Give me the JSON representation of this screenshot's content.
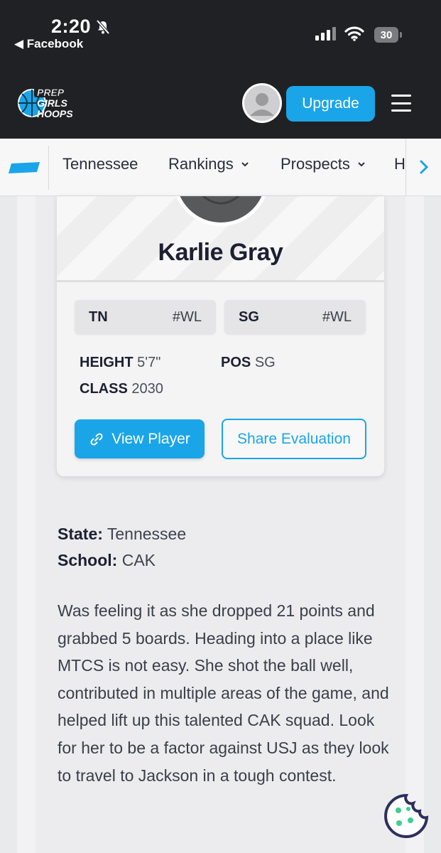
{
  "status_bar": {
    "time": "2:20",
    "back_label": "◀ Facebook",
    "battery": "30"
  },
  "header": {
    "logo_lines": [
      "PREP",
      "GIRLS",
      "HOOPS"
    ],
    "upgrade_label": "Upgrade"
  },
  "nav": {
    "items": [
      {
        "label": "Tennessee",
        "has_dropdown": false
      },
      {
        "label": "Rankings",
        "has_dropdown": true
      },
      {
        "label": "Prospects",
        "has_dropdown": true
      }
    ],
    "cut_item": "H",
    "dropdown_glyph": "⌄"
  },
  "player": {
    "name": "Karlie Gray",
    "rank_chips": [
      {
        "label": "TN",
        "value": "#WL"
      },
      {
        "label": "SG",
        "value": "#WL"
      }
    ],
    "height_label": "HEIGHT",
    "height_value": "5'7\"",
    "class_label": "CLASS",
    "class_value": "2030",
    "pos_label": "POS",
    "pos_value": "SG",
    "view_button": "View Player",
    "share_button": "Share Evaluation"
  },
  "details": {
    "state_label": "State:",
    "state_value": "Tennessee",
    "school_label": "School:",
    "school_value": "CAK"
  },
  "evaluation": "Was feeling it as she dropped 21 points and grabbed 5 boards. Heading into a place like MTCS is not easy. She shot the ball well, contributed in multiple areas of the game, and helped lift up this talented CAK squad. Look for her to be a factor against USJ as they look to travel to Jackson in a tough contest.",
  "colors": {
    "accent": "#1aa5e8",
    "header_bg": "#202124",
    "text_dark": "#1c2032"
  }
}
